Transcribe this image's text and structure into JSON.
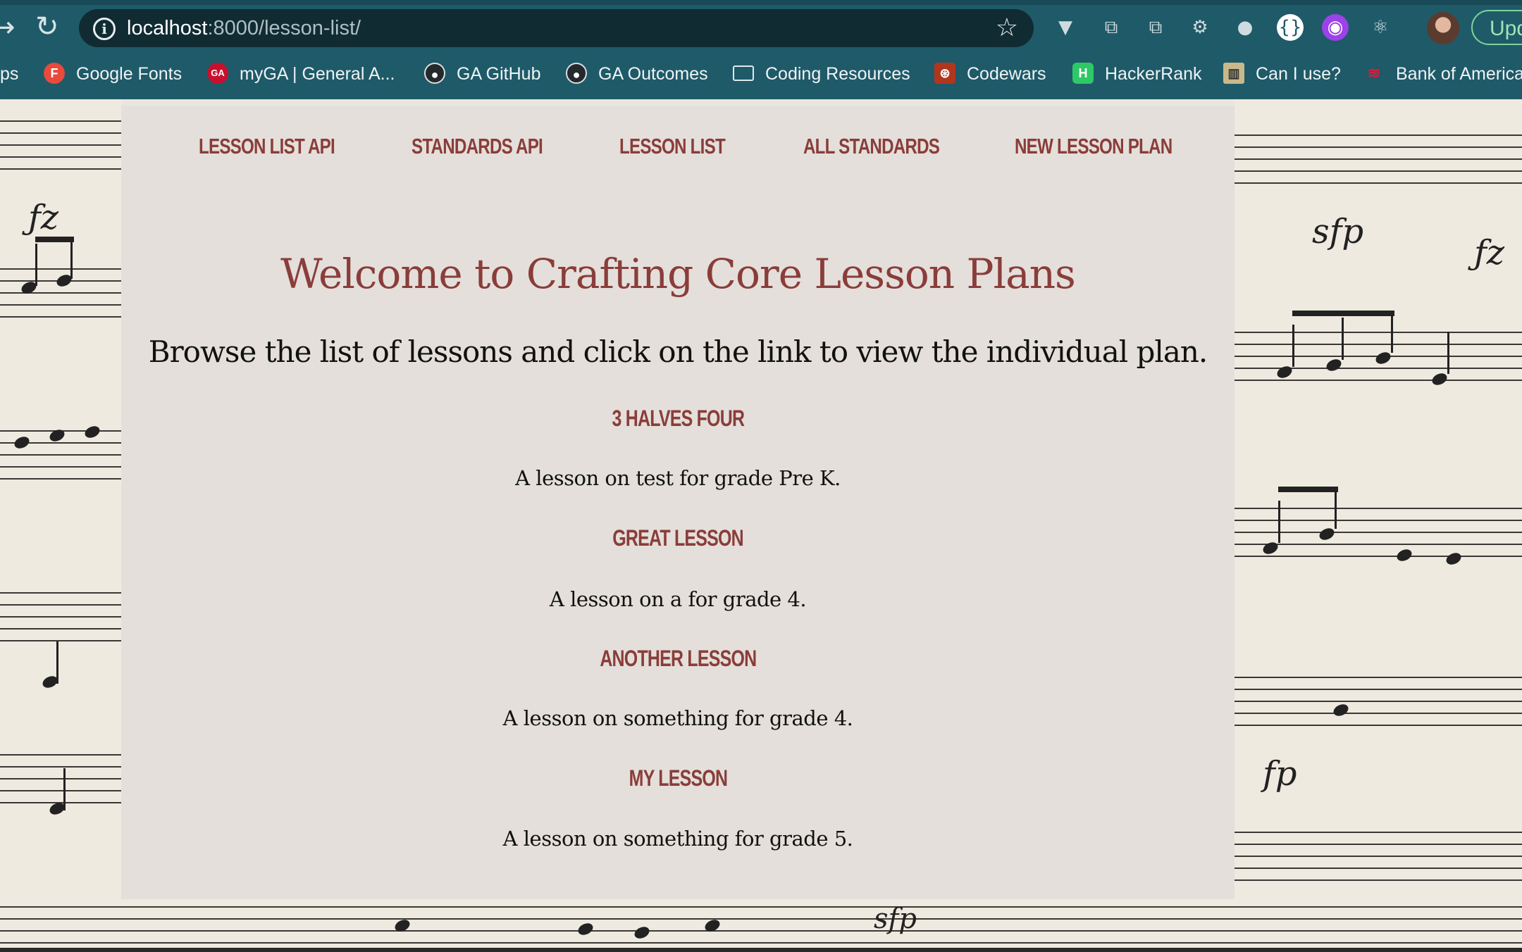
{
  "browser": {
    "url_host": "localhost",
    "url_path": ":8000/lesson-list/",
    "update_label": "Upd",
    "bookmarks": [
      {
        "label": "ps",
        "icon": "apps-icon"
      },
      {
        "label": "Google Fonts",
        "icon": "google-fonts-icon",
        "color": "#e84a3c",
        "glyph": "F"
      },
      {
        "label": "myGA | General A...",
        "icon": "general-assembly-icon",
        "color": "#c8102e",
        "glyph": "GA"
      },
      {
        "label": "GA GitHub",
        "icon": "github-icon",
        "color": "#24292e",
        "glyph": "●"
      },
      {
        "label": "GA Outcomes",
        "icon": "github-icon",
        "color": "#24292e",
        "glyph": "●"
      },
      {
        "label": "Coding Resources",
        "icon": "folder-icon"
      },
      {
        "label": "Codewars",
        "icon": "codewars-icon",
        "color": "#b1361e",
        "glyph": "⊛"
      },
      {
        "label": "HackerRank",
        "icon": "hackerrank-icon",
        "color": "#2ec866",
        "glyph": "H"
      },
      {
        "label": "Can I use?",
        "icon": "caniuse-icon",
        "color": "#c9b98a",
        "glyph": "▥"
      },
      {
        "label": "Bank of America",
        "icon": "bank-of-america-icon",
        "color": "#e31837",
        "glyph": "≋"
      }
    ]
  },
  "nav": {
    "links": [
      "LESSON LIST API",
      "STANDARDS API",
      "LESSON LIST",
      "ALL STANDARDS",
      "NEW LESSON PLAN"
    ]
  },
  "page": {
    "title": "Welcome to Crafting Core Lesson Plans",
    "subtitle": "Browse the list of lessons and click on the link to view the individual plan."
  },
  "lessons": [
    {
      "title": "3 HALVES FOUR",
      "description": "A lesson on test for grade Pre K."
    },
    {
      "title": "GREAT LESSON",
      "description": "A lesson on a for grade 4."
    },
    {
      "title": "ANOTHER LESSON",
      "description": "A lesson on something for grade 4."
    },
    {
      "title": "MY LESSON",
      "description": "A lesson on something for grade 5."
    }
  ]
}
